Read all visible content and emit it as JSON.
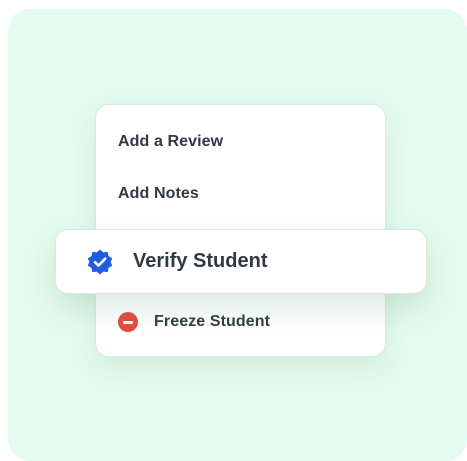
{
  "menu": {
    "items": [
      {
        "label": "Add a Review"
      },
      {
        "label": "Add Notes"
      },
      {
        "label": "Verify Student",
        "icon": "verified-badge-icon",
        "color": "#1f5ce0",
        "highlighted": true
      },
      {
        "label": "Freeze Student",
        "icon": "minus-circle-icon",
        "color": "#e34b3f"
      }
    ]
  },
  "colors": {
    "background_panel": "#e4fbef",
    "card": "#ffffff",
    "text": "#2f3a45"
  }
}
